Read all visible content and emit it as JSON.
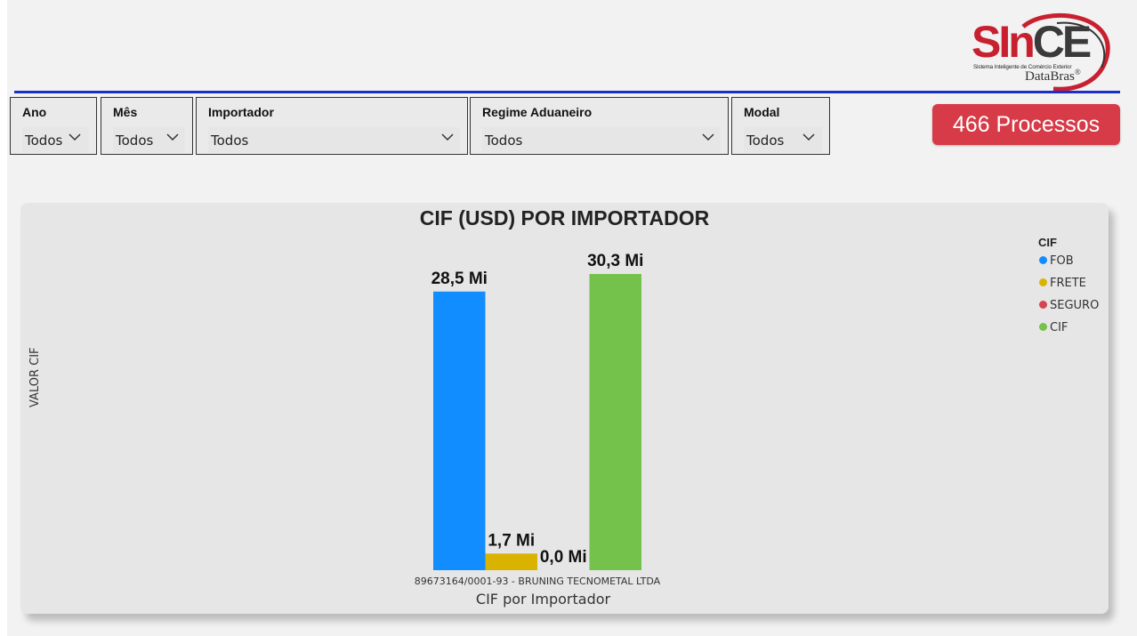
{
  "logo": {
    "brand_red": "SIn",
    "brand_dark": "CE",
    "tagline": "Sistema Inteligente de Comércio Exterior",
    "sub": "DataBras",
    "reg": "®"
  },
  "slicers": [
    {
      "label": "Ano",
      "value": "Todos"
    },
    {
      "label": "Mês",
      "value": "Todos"
    },
    {
      "label": "Importador",
      "value": "Todos"
    },
    {
      "label": "Regime Aduaneiro",
      "value": "Todos"
    },
    {
      "label": "Modal",
      "value": "Todos"
    }
  ],
  "process_button": {
    "label": "466 Processos",
    "color": "#d63b47"
  },
  "chart_data": {
    "type": "bar",
    "title": "CIF (USD) POR IMPORTADOR",
    "xlabel": "CIF por Importador",
    "ylabel": "VALOR CIF",
    "categories": [
      "89673164/0001-93 - BRUNING TECNOMETAL LTDA"
    ],
    "legend_title": "CIF",
    "legend_position": "top-right",
    "series": [
      {
        "name": "FOB",
        "color": "#118dff",
        "values": [
          28.5
        ],
        "label": "28,5 Mi"
      },
      {
        "name": "FRETE",
        "color": "#d9b300",
        "values": [
          1.7
        ],
        "label": "1,7 Mi"
      },
      {
        "name": "SEGURO",
        "color": "#d64550",
        "values": [
          0.0
        ],
        "label": "0,0 Mi"
      },
      {
        "name": "CIF",
        "color": "#74c24b",
        "values": [
          30.3
        ],
        "label": "30,3 Mi"
      }
    ],
    "ylim": [
      0,
      30.3
    ],
    "grid": false
  }
}
